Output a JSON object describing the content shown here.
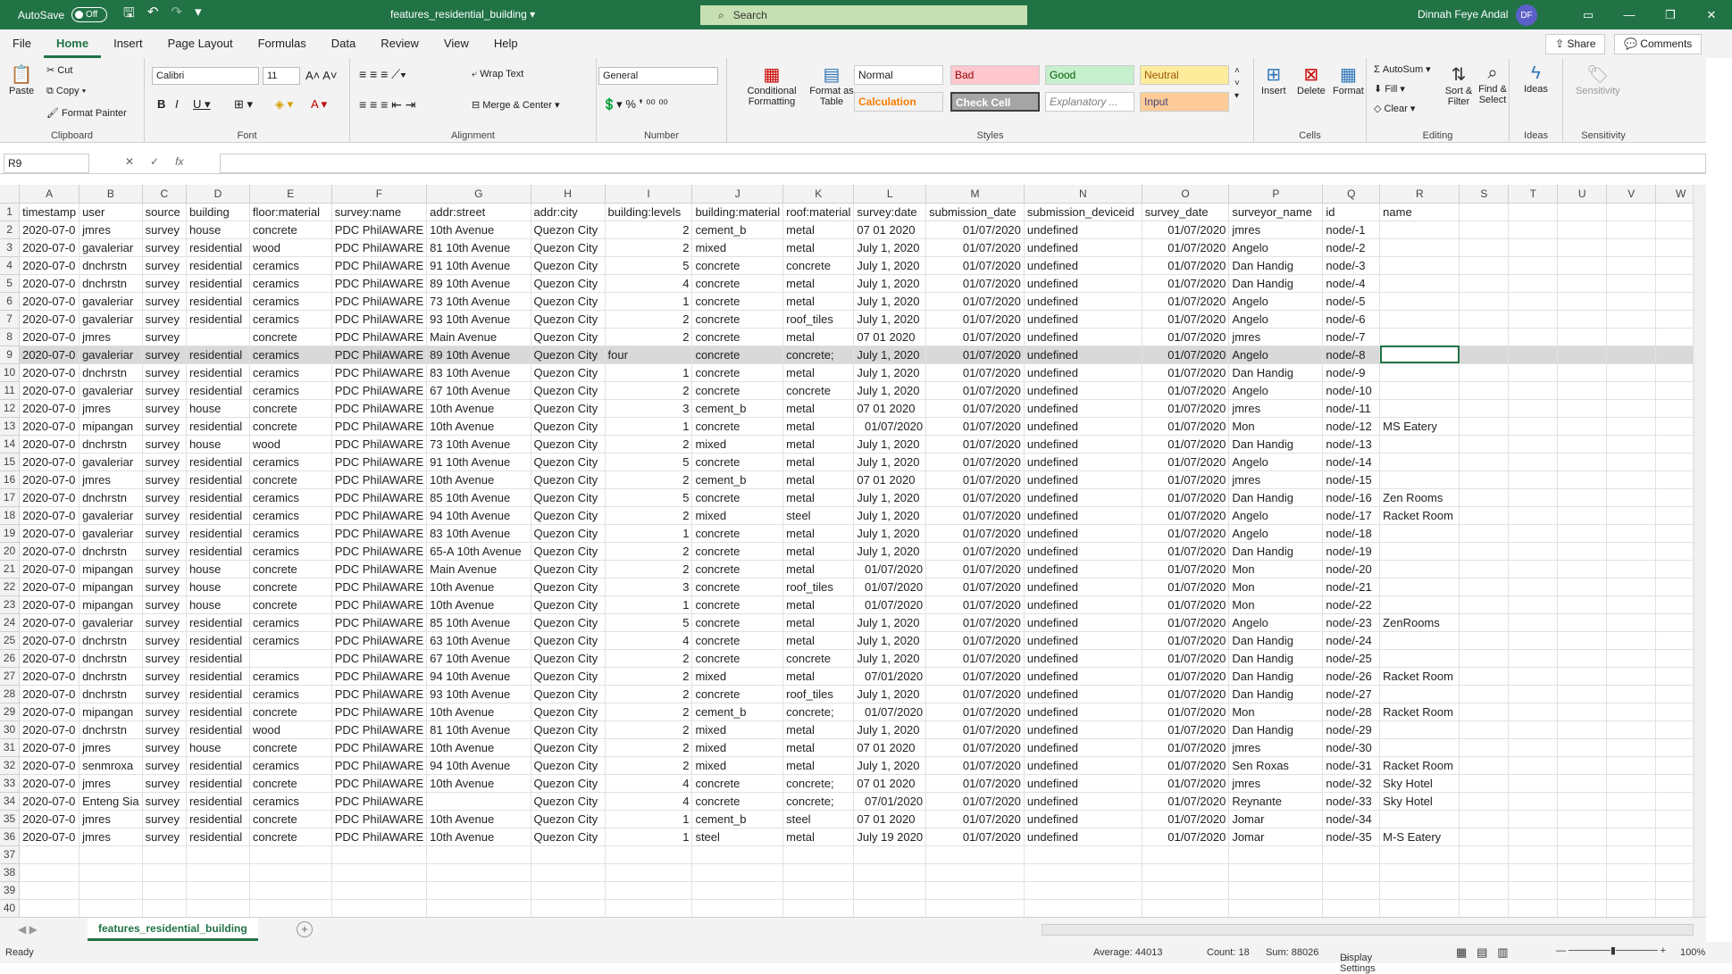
{
  "window": {
    "autosave_label": "AutoSave",
    "autosave_state": "Off",
    "doc_title": "features_residential_building",
    "search_placeholder": "Search",
    "user_name": "Dinnah Feye Andal",
    "user_initials": "DF"
  },
  "menu": {
    "tabs": [
      "File",
      "Home",
      "Insert",
      "Page Layout",
      "Formulas",
      "Data",
      "Review",
      "View",
      "Help"
    ],
    "active": "Home",
    "share": "Share",
    "comments": "Comments"
  },
  "ribbon": {
    "clipboard": {
      "paste": "Paste",
      "cut": "Cut",
      "copy": "Copy",
      "format_painter": "Format Painter",
      "label": "Clipboard"
    },
    "font": {
      "name": "Calibri",
      "size": "11",
      "label": "Font"
    },
    "alignment": {
      "wrap": "Wrap Text",
      "merge": "Merge & Center",
      "label": "Alignment"
    },
    "number": {
      "format": "General",
      "label": "Number"
    },
    "styles": {
      "conditional": "Conditional Formatting",
      "format_table": "Format as Table",
      "normal": "Normal",
      "bad": "Bad",
      "good": "Good",
      "neutral": "Neutral",
      "calculation": "Calculation",
      "check": "Check Cell",
      "explanatory": "Explanatory ...",
      "input": "Input",
      "label": "Styles"
    },
    "cells": {
      "insert": "Insert",
      "delete": "Delete",
      "format": "Format",
      "label": "Cells"
    },
    "editing": {
      "autosum": "AutoSum",
      "fill": "Fill",
      "clear": "Clear",
      "sort": "Sort & Filter",
      "find": "Find & Select",
      "label": "Editing"
    },
    "ideas": {
      "btn": "Ideas",
      "label": "Ideas"
    },
    "sensitivity": {
      "btn": "Sensitivity",
      "label": "Sensitivity"
    }
  },
  "formula_bar": {
    "name_box": "R9",
    "fx": "fx"
  },
  "columns": [
    "A",
    "B",
    "C",
    "D",
    "E",
    "F",
    "G",
    "H",
    "I",
    "J",
    "K",
    "L",
    "M",
    "N",
    "O",
    "P",
    "Q",
    "R",
    "S",
    "T",
    "U",
    "V",
    "W"
  ],
  "header_row": [
    "timestamp",
    "user",
    "source",
    "building",
    "floor:material",
    "survey:name",
    "addr:street",
    "addr:city",
    "building:levels",
    "building:material",
    "roof:material",
    "survey:date",
    "submission_date",
    "submission_deviceid",
    "survey_date",
    "surveyor_name",
    "id",
    "name",
    "",
    "",
    "",
    "",
    ""
  ],
  "rows": [
    [
      "2020-07-0",
      "jmres",
      "survey",
      "house",
      "concrete",
      "PDC PhilAWARE",
      "10th Avenue",
      "Quezon City",
      "2",
      "cement_b",
      "metal",
      "07 01 2020",
      "01/07/2020",
      "undefined",
      "01/07/2020",
      "jmres",
      "node/-1",
      ""
    ],
    [
      "2020-07-0",
      "gavaleriar",
      "survey",
      "residential",
      "wood",
      "PDC PhilAWARE",
      "81 10th Avenue",
      "Quezon City",
      "2",
      "mixed",
      "metal",
      "July 1, 2020",
      "01/07/2020",
      "undefined",
      "01/07/2020",
      "Angelo",
      "node/-2",
      ""
    ],
    [
      "2020-07-0",
      "dnchrstn",
      "survey",
      "residential",
      "ceramics",
      "PDC PhilAWARE",
      "91 10th Avenue",
      "Quezon City",
      "5",
      "concrete",
      "concrete",
      "July 1, 2020",
      "01/07/2020",
      "undefined",
      "01/07/2020",
      "Dan Handig",
      "node/-3",
      ""
    ],
    [
      "2020-07-0",
      "dnchrstn",
      "survey",
      "residential",
      "ceramics",
      "PDC PhilAWARE",
      "89 10th Avenue",
      "Quezon City",
      "4",
      "concrete",
      "metal",
      "July 1, 2020",
      "01/07/2020",
      "undefined",
      "01/07/2020",
      "Dan Handig",
      "node/-4",
      ""
    ],
    [
      "2020-07-0",
      "gavaleriar",
      "survey",
      "residential",
      "ceramics",
      "PDC PhilAWARE",
      "73 10th Avenue",
      "Quezon City",
      "1",
      "concrete",
      "metal",
      "July 1, 2020",
      "01/07/2020",
      "undefined",
      "01/07/2020",
      "Angelo",
      "node/-5",
      ""
    ],
    [
      "2020-07-0",
      "gavaleriar",
      "survey",
      "residential",
      "ceramics",
      "PDC PhilAWARE",
      "93 10th Avenue",
      "Quezon City",
      "2",
      "concrete",
      "roof_tiles",
      "July 1, 2020",
      "01/07/2020",
      "undefined",
      "01/07/2020",
      "Angelo",
      "node/-6",
      ""
    ],
    [
      "2020-07-0",
      "jmres",
      "survey",
      "",
      "concrete",
      "PDC PhilAWARE",
      "Main Avenue",
      "Quezon City",
      "2",
      "concrete",
      "metal",
      "07 01 2020",
      "01/07/2020",
      "undefined",
      "01/07/2020",
      "jmres",
      "node/-7",
      ""
    ],
    [
      "2020-07-0",
      "gavaleriar",
      "survey",
      "residential",
      "ceramics",
      "PDC PhilAWARE",
      "89 10th Avenue",
      "Quezon City",
      "four",
      "concrete",
      "concrete;",
      "July 1, 2020",
      "01/07/2020",
      "undefined",
      "01/07/2020",
      "Angelo",
      "node/-8",
      ""
    ],
    [
      "2020-07-0",
      "dnchrstn",
      "survey",
      "residential",
      "ceramics",
      "PDC PhilAWARE",
      "83 10th Avenue",
      "Quezon City",
      "1",
      "concrete",
      "metal",
      "July 1, 2020",
      "01/07/2020",
      "undefined",
      "01/07/2020",
      "Dan Handig",
      "node/-9",
      ""
    ],
    [
      "2020-07-0",
      "gavaleriar",
      "survey",
      "residential",
      "ceramics",
      "PDC PhilAWARE",
      "67 10th Avenue",
      "Quezon City",
      "2",
      "concrete",
      "concrete",
      "July 1, 2020",
      "01/07/2020",
      "undefined",
      "01/07/2020",
      "Angelo",
      "node/-10",
      ""
    ],
    [
      "2020-07-0",
      "jmres",
      "survey",
      "house",
      "concrete",
      "PDC PhilAWARE",
      "10th Avenue",
      "Quezon City",
      "3",
      "cement_b",
      "metal",
      "07 01 2020",
      "01/07/2020",
      "undefined",
      "01/07/2020",
      "jmres",
      "node/-11",
      ""
    ],
    [
      "2020-07-0",
      "mipangan",
      "survey",
      "residential",
      "concrete",
      "PDC PhilAWARE",
      "10th Avenue",
      "Quezon City",
      "1",
      "concrete",
      "metal",
      "01/07/2020",
      "01/07/2020",
      "undefined",
      "01/07/2020",
      "Mon",
      "node/-12",
      "MS Eatery"
    ],
    [
      "2020-07-0",
      "dnchrstn",
      "survey",
      "house",
      "wood",
      "PDC PhilAWARE",
      "73 10th Avenue",
      "Quezon City",
      "2",
      "mixed",
      "metal",
      "July 1, 2020",
      "01/07/2020",
      "undefined",
      "01/07/2020",
      "Dan Handig",
      "node/-13",
      ""
    ],
    [
      "2020-07-0",
      "gavaleriar",
      "survey",
      "residential",
      "ceramics",
      "PDC PhilAWARE",
      "91 10th Avenue",
      "Quezon City",
      "5",
      "concrete",
      "metal",
      "July 1, 2020",
      "01/07/2020",
      "undefined",
      "01/07/2020",
      "Angelo",
      "node/-14",
      ""
    ],
    [
      "2020-07-0",
      "jmres",
      "survey",
      "residential",
      "concrete",
      "PDC PhilAWARE",
      "10th Avenue",
      "Quezon City",
      "2",
      "cement_b",
      "metal",
      "07 01 2020",
      "01/07/2020",
      "undefined",
      "01/07/2020",
      "jmres",
      "node/-15",
      ""
    ],
    [
      "2020-07-0",
      "dnchrstn",
      "survey",
      "residential",
      "ceramics",
      "PDC PhilAWARE",
      "85 10th Avenue",
      "Quezon City",
      "5",
      "concrete",
      "metal",
      "July 1, 2020",
      "01/07/2020",
      "undefined",
      "01/07/2020",
      "Dan Handig",
      "node/-16",
      "Zen Rooms"
    ],
    [
      "2020-07-0",
      "gavaleriar",
      "survey",
      "residential",
      "ceramics",
      "PDC PhilAWARE",
      "94 10th Avenue",
      "Quezon City",
      "2",
      "mixed",
      "steel",
      "July 1, 2020",
      "01/07/2020",
      "undefined",
      "01/07/2020",
      "Angelo",
      "node/-17",
      "Racket Room"
    ],
    [
      "2020-07-0",
      "gavaleriar",
      "survey",
      "residential",
      "ceramics",
      "PDC PhilAWARE",
      "83 10th Avenue",
      "Quezon City",
      "1",
      "concrete",
      "metal",
      "July 1, 2020",
      "01/07/2020",
      "undefined",
      "01/07/2020",
      "Angelo",
      "node/-18",
      ""
    ],
    [
      "2020-07-0",
      "dnchrstn",
      "survey",
      "residential",
      "ceramics",
      "PDC PhilAWARE",
      "65-A 10th Avenue",
      "Quezon City",
      "2",
      "concrete",
      "metal",
      "July 1, 2020",
      "01/07/2020",
      "undefined",
      "01/07/2020",
      "Dan Handig",
      "node/-19",
      ""
    ],
    [
      "2020-07-0",
      "mipangan",
      "survey",
      "house",
      "concrete",
      "PDC PhilAWARE",
      "Main Avenue",
      "Quezon City",
      "2",
      "concrete",
      "metal",
      "01/07/2020",
      "01/07/2020",
      "undefined",
      "01/07/2020",
      "Mon",
      "node/-20",
      ""
    ],
    [
      "2020-07-0",
      "mipangan",
      "survey",
      "house",
      "concrete",
      "PDC PhilAWARE",
      "10th Avenue",
      "Quezon City",
      "3",
      "concrete",
      "roof_tiles",
      "01/07/2020",
      "01/07/2020",
      "undefined",
      "01/07/2020",
      "Mon",
      "node/-21",
      ""
    ],
    [
      "2020-07-0",
      "mipangan",
      "survey",
      "house",
      "concrete",
      "PDC PhilAWARE",
      "10th Avenue",
      "Quezon City",
      "1",
      "concrete",
      "metal",
      "01/07/2020",
      "01/07/2020",
      "undefined",
      "01/07/2020",
      "Mon",
      "node/-22",
      ""
    ],
    [
      "2020-07-0",
      "gavaleriar",
      "survey",
      "residential",
      "ceramics",
      "PDC PhilAWARE",
      "85 10th Avenue",
      "Quezon City",
      "5",
      "concrete",
      "metal",
      "July 1, 2020",
      "01/07/2020",
      "undefined",
      "01/07/2020",
      "Angelo",
      "node/-23",
      "ZenRooms"
    ],
    [
      "2020-07-0",
      "dnchrstn",
      "survey",
      "residential",
      "ceramics",
      "PDC PhilAWARE",
      "63 10th Avenue",
      "Quezon City",
      "4",
      "concrete",
      "metal",
      "July 1, 2020",
      "01/07/2020",
      "undefined",
      "01/07/2020",
      "Dan Handig",
      "node/-24",
      ""
    ],
    [
      "2020-07-0",
      "dnchrstn",
      "survey",
      "residential",
      "",
      "PDC PhilAWARE",
      "67 10th Avenue",
      "Quezon City",
      "2",
      "concrete",
      "concrete",
      "July 1, 2020",
      "01/07/2020",
      "undefined",
      "01/07/2020",
      "Dan Handig",
      "node/-25",
      ""
    ],
    [
      "2020-07-0",
      "dnchrstn",
      "survey",
      "residential",
      "ceramics",
      "PDC PhilAWARE",
      "94 10th Avenue",
      "Quezon City",
      "2",
      "mixed",
      "metal",
      "07/01/2020",
      "01/07/2020",
      "undefined",
      "01/07/2020",
      "Dan Handig",
      "node/-26",
      "Racket Room"
    ],
    [
      "2020-07-0",
      "dnchrstn",
      "survey",
      "residential",
      "ceramics",
      "PDC PhilAWARE",
      "93 10th Avenue",
      "Quezon City",
      "2",
      "concrete",
      "roof_tiles",
      "July 1, 2020",
      "01/07/2020",
      "undefined",
      "01/07/2020",
      "Dan Handig",
      "node/-27",
      ""
    ],
    [
      "2020-07-0",
      "mipangan",
      "survey",
      "residential",
      "concrete",
      "PDC PhilAWARE",
      "10th Avenue",
      "Quezon City",
      "2",
      "cement_b",
      "concrete;",
      "01/07/2020",
      "01/07/2020",
      "undefined",
      "01/07/2020",
      "Mon",
      "node/-28",
      "Racket Room"
    ],
    [
      "2020-07-0",
      "dnchrstn",
      "survey",
      "residential",
      "wood",
      "PDC PhilAWARE",
      "81 10th Avenue",
      "Quezon City",
      "2",
      "mixed",
      "metal",
      "July 1, 2020",
      "01/07/2020",
      "undefined",
      "01/07/2020",
      "Dan Handig",
      "node/-29",
      ""
    ],
    [
      "2020-07-0",
      "jmres",
      "survey",
      "house",
      "concrete",
      "PDC PhilAWARE",
      "10th Avenue",
      "Quezon City",
      "2",
      "mixed",
      "metal",
      "07 01 2020",
      "01/07/2020",
      "undefined",
      "01/07/2020",
      "jmres",
      "node/-30",
      ""
    ],
    [
      "2020-07-0",
      "senmroxa",
      "survey",
      "residential",
      "ceramics",
      "PDC PhilAWARE",
      "94 10th Avenue",
      "Quezon City",
      "2",
      "mixed",
      "metal",
      "July 1, 2020",
      "01/07/2020",
      "undefined",
      "01/07/2020",
      "Sen Roxas",
      "node/-31",
      "Racket Room"
    ],
    [
      "2020-07-0",
      "jmres",
      "survey",
      "residential",
      "concrete",
      "PDC PhilAWARE",
      "10th Avenue",
      "Quezon City",
      "4",
      "concrete",
      "concrete;",
      "07 01 2020",
      "01/07/2020",
      "undefined",
      "01/07/2020",
      "jmres",
      "node/-32",
      "Sky Hotel"
    ],
    [
      "2020-07-0",
      "Enteng Sia",
      "survey",
      "residential",
      "ceramics",
      "PDC PhilAWARE",
      "",
      "Quezon City",
      "4",
      "concrete",
      "concrete;",
      "07/01/2020",
      "01/07/2020",
      "undefined",
      "01/07/2020",
      "Reynante",
      "node/-33",
      "Sky Hotel"
    ],
    [
      "2020-07-0",
      "jmres",
      "survey",
      "residential",
      "concrete",
      "PDC PhilAWARE",
      "10th Avenue",
      "Quezon City",
      "1",
      "cement_b",
      "steel",
      "07 01 2020",
      "01/07/2020",
      "undefined",
      "01/07/2020",
      "Jomar",
      "node/-34",
      ""
    ],
    [
      "2020-07-0",
      "jmres",
      "survey",
      "residential",
      "concrete",
      "PDC PhilAWARE",
      "10th Avenue",
      "Quezon City",
      "1",
      "steel",
      "metal",
      "July 19 2020",
      "01/07/2020",
      "undefined",
      "01/07/2020",
      "Jomar",
      "node/-35",
      "M-S Eatery"
    ]
  ],
  "empty_rows": [
    37,
    38,
    39,
    40
  ],
  "sheet": {
    "tab": "features_residential_building"
  },
  "status": {
    "ready": "Ready",
    "average": "Average: 44013",
    "count": "Count: 18",
    "sum": "Sum: 88026",
    "display": "Display Settings",
    "zoom": "100%"
  }
}
